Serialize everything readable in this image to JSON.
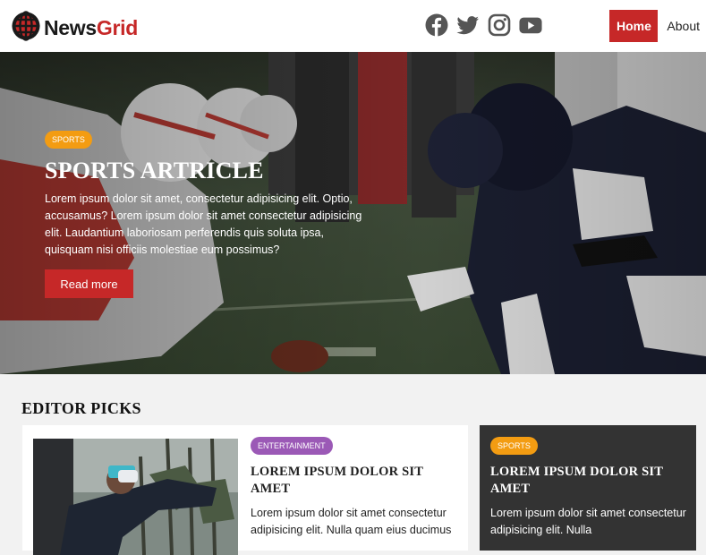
{
  "brand": {
    "name_part1": "News",
    "name_part2": "Grid"
  },
  "social": [
    {
      "icon": "facebook-icon"
    },
    {
      "icon": "twitter-icon"
    },
    {
      "icon": "instagram-icon"
    },
    {
      "icon": "youtube-icon"
    }
  ],
  "nav": {
    "home": "Home",
    "about": "About"
  },
  "hero": {
    "badge": "SPORTS",
    "title": "SPORTS ARTRICLE",
    "text": "Lorem ipsum dolor sit amet, consectetur adipisicing elit. Optio, accusamus? Lorem ipsum dolor sit amet consectetur adipisicing elit. Laudantium laboriosam perferendis quis soluta ipsa, quisquam nisi officiis molestiae eum possimus?",
    "button": "Read more"
  },
  "editor_picks": {
    "heading": "EDITOR PICKS",
    "cards": [
      {
        "badge": "ENTERTAINMENT",
        "title": "LOREM IPSUM DOLOR SIT AMET",
        "text": "Lorem ipsum dolor sit amet consectetur adipisicing elit. Nulla quam eius ducimus"
      },
      {
        "badge": "SPORTS",
        "title": "LOREM IPSUM DOLOR SIT AMET",
        "text": "Lorem ipsum dolor sit amet consectetur adipisicing elit. Nulla"
      }
    ]
  },
  "colors": {
    "accent": "#c62828",
    "sports": "#f39c12",
    "entertainment": "#9b59b6",
    "dark_card": "#333333"
  }
}
